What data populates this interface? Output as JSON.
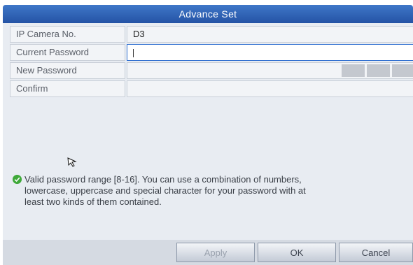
{
  "dialog": {
    "title": "Advance Set"
  },
  "form": {
    "rows": [
      {
        "label": "IP Camera No.",
        "value": "D3"
      },
      {
        "label": "Current Password",
        "value": ""
      },
      {
        "label": "New Password",
        "value": ""
      },
      {
        "label": "Confirm",
        "value": ""
      }
    ]
  },
  "hint": {
    "line1": "Valid password range [8-16]. You can use a combination of numbers,",
    "line2": "lowercase, uppercase and special character for your password with at",
    "line3": "least two kinds of them contained."
  },
  "buttons": {
    "apply": "Apply",
    "ok": "OK",
    "cancel": "Cancel"
  },
  "colors": {
    "titlebar": "#2f63b8",
    "check": "#3fa93a"
  },
  "icons": {
    "check": "check-circle-icon",
    "cursor": "mouse-pointer-icon"
  }
}
